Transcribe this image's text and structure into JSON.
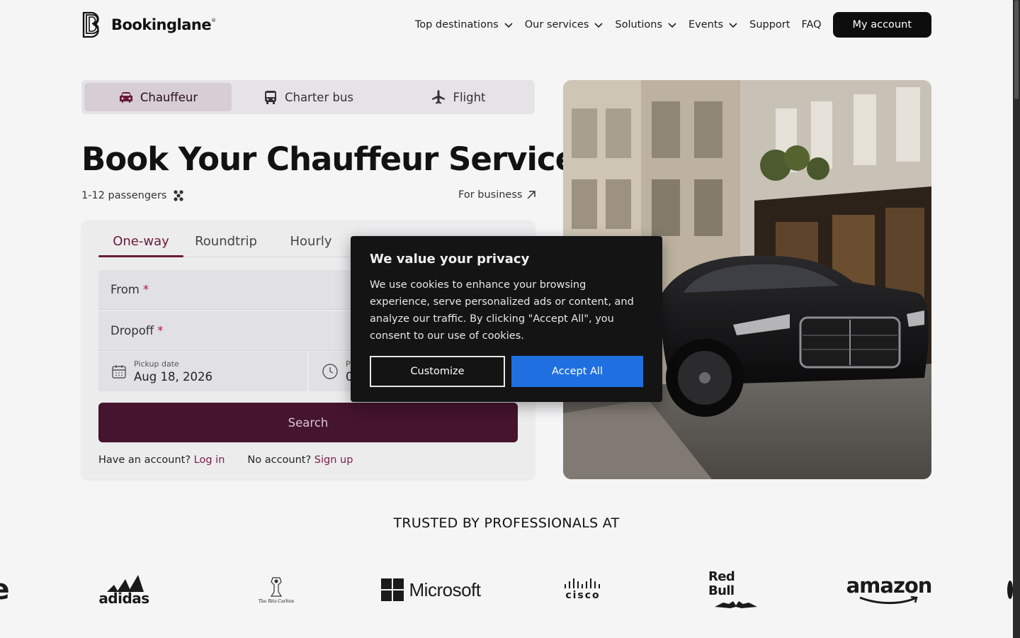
{
  "header": {
    "brand": "Bookinglane",
    "brand_mark": "®",
    "nav": [
      {
        "label": "Top destinations",
        "dropdown": true
      },
      {
        "label": "Our services",
        "dropdown": true
      },
      {
        "label": "Solutions",
        "dropdown": true
      },
      {
        "label": "Events",
        "dropdown": true
      },
      {
        "label": "Support",
        "dropdown": false
      },
      {
        "label": "FAQ",
        "dropdown": false
      }
    ],
    "account_label": "My account"
  },
  "mode_tabs": [
    {
      "label": "Chauffeur",
      "icon": "car-icon",
      "active": true
    },
    {
      "label": "Charter bus",
      "icon": "bus-icon",
      "active": false
    },
    {
      "label": "Flight",
      "icon": "plane-icon",
      "active": false
    }
  ],
  "hero": {
    "title": "Book Your Chauffeur Service",
    "passengers": "1-12 passengers",
    "business_link": "For business"
  },
  "form": {
    "trip_tabs": [
      {
        "label": "One-way",
        "active": true
      },
      {
        "label": "Roundtrip",
        "active": false
      },
      {
        "label": "Hourly",
        "active": false
      }
    ],
    "from_label": "From",
    "dropoff_label": "Dropoff",
    "required_mark": "*",
    "pickup_date_label": "Pickup date",
    "pickup_date_value": "Aug 18, 2026",
    "pickup_time_label": "Pi",
    "pickup_time_value": "0",
    "search_label": "Search",
    "have_account": "Have an account?",
    "login": "Log in",
    "no_account": "No account?",
    "signup": "Sign up"
  },
  "trusted": {
    "heading": "TRUSTED BY PROFESSIONALS AT",
    "brands": [
      "adidas",
      "The Ritz-Carlton",
      "Microsoft",
      "cisco",
      "Red Bull",
      "amazon"
    ]
  },
  "cookie": {
    "title": "We value your privacy",
    "body": "We use cookies to enhance your browsing experience, serve personalized ads or content, and analyze our traffic. By clicking \"Accept All\", you consent to our use of cookies.",
    "customize": "Customize",
    "accept": "Accept All"
  },
  "colors": {
    "accent": "#45142e",
    "accent_text": "#7a1c43",
    "accept_blue": "#1f6fe0"
  }
}
